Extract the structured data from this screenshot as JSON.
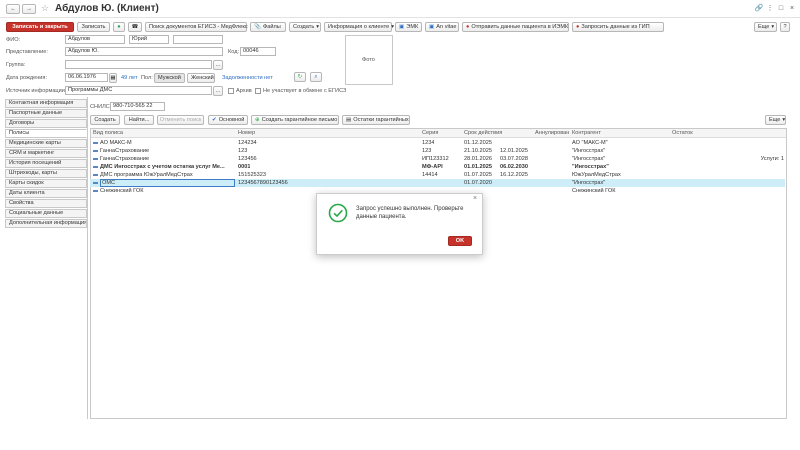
{
  "window": {
    "title": "Абдулов Ю. (Клиент)",
    "controls": [
      "link-icon",
      "more-icon",
      "maximize-icon",
      "close-icon"
    ]
  },
  "toolbar": {
    "save_close": "Записать и закрыть",
    "save": "Записать",
    "search_egisz": "Поиск документов ЕГИСЗ - МедФлекс",
    "files": "Файлы",
    "create": "Создать",
    "client_info": "Информация о клиенте",
    "emk": "ЭМК",
    "anvitae": "An vitae",
    "send_iemk": "Отправить данные пациента в ИЭМК",
    "request_gip": "Запросить данные из ГИП",
    "more": "Еще"
  },
  "form": {
    "fio_label": "ФИО:",
    "last_name": "Абдулов",
    "first_name": "Юрий",
    "middle_name": "",
    "photo_label": "Фото",
    "representation_label": "Представление:",
    "representation": "Абдулов Ю.",
    "code_label": "Код:",
    "code": "00046",
    "group_label": "Группа:",
    "group": "",
    "birthdate_label": "Дата рождения:",
    "birthdate": "06.06.1976",
    "age": "49 лет",
    "sex_label": "Пол:",
    "sex_male": "Мужской",
    "sex_female": "Женский",
    "debt": "Задолженности нет",
    "source_label": "Источник информации:",
    "source": "Программы ДМС",
    "archive_label": "Архив",
    "no_exchange_label": "Не участвует в обмене с ЕГИСЗ"
  },
  "sidebar": {
    "items": [
      {
        "label": "Контактная информация",
        "active": false
      },
      {
        "label": "Паспортные данные",
        "active": false
      },
      {
        "label": "Договоры",
        "active": false
      },
      {
        "label": "Полисы",
        "active": true
      },
      {
        "label": "Медицинские карты",
        "active": false
      },
      {
        "label": "CRM и маркетинг",
        "active": false
      },
      {
        "label": "История посещений",
        "active": false
      },
      {
        "label": "Штрихкоды, карты",
        "active": false
      },
      {
        "label": "Карты скидок",
        "active": false
      },
      {
        "label": "Даты клиента",
        "active": false
      },
      {
        "label": "Свойства",
        "active": false
      },
      {
        "label": "Социальные данные",
        "active": false
      },
      {
        "label": "Дополнительная информация",
        "active": false
      }
    ]
  },
  "policies": {
    "snils_label": "СНИЛС:",
    "snils": "980-710-565 22",
    "btn_create": "Создать",
    "btn_find": "Найти...",
    "btn_cancel_search": "Отменить поиск",
    "btn_main": "Основной",
    "btn_guarantee": "Создать гарантийное письмо",
    "btn_remains": "Остатки гарантийных",
    "btn_more": "Еще",
    "columns": [
      "Вид полиса",
      "Номер",
      "Серия",
      "Срок действия",
      "",
      "Аннулирован",
      "Контрагент",
      "Остаток"
    ],
    "rows": [
      {
        "type": "АО МАКС-М",
        "number": "124234",
        "series": "1234",
        "date_from": "01.12.2025",
        "date_to": "",
        "annulled": "",
        "contractor": "АО \"МАКС-М\"",
        "remainder": "",
        "bold": false,
        "selected": false
      },
      {
        "type": "ГаннаСтрахование",
        "number": "123",
        "series": "123",
        "date_from": "21.10.2025",
        "date_to": "12.01.2025",
        "annulled": "",
        "contractor": "\"Ингосстрах\"",
        "remainder": "",
        "bold": false,
        "selected": false
      },
      {
        "type": "ГаннаСтрахование",
        "number": "123456",
        "series": "ИП123312",
        "date_from": "28.01.2026",
        "date_to": "03.07.2028",
        "annulled": "",
        "contractor": "\"Ингосстрах\"",
        "remainder": "Услуги: 1",
        "bold": false,
        "selected": false
      },
      {
        "type": "ДМС Ингосстрах с учетом остатка услуг Ме...",
        "number": "0001",
        "series": "МФ-API",
        "date_from": "01.01.2025",
        "date_to": "06.02.2030",
        "annulled": "",
        "contractor": "\"Ингосстрах\"",
        "remainder": "",
        "bold": true,
        "selected": false
      },
      {
        "type": "ДМС программа ЮжУралМедСтрах",
        "number": "151525323",
        "series": "14414",
        "date_from": "01.07.2025",
        "date_to": "16.12.2025",
        "annulled": "",
        "contractor": "ЮжУралМедСтрах",
        "remainder": "",
        "bold": false,
        "selected": false
      },
      {
        "type": "ОМС",
        "number": "1234567890123456",
        "series": "",
        "date_from": "01.07.2020",
        "date_to": "",
        "annulled": "",
        "contractor": "\"Ингосстрах\"",
        "remainder": "",
        "bold": false,
        "selected": true
      },
      {
        "type": "Снежинский ГОК",
        "number": "",
        "series": "",
        "date_from": "",
        "date_to": "",
        "annulled": "",
        "contractor": "Снежинский ГОК",
        "remainder": "",
        "bold": false,
        "selected": false
      }
    ]
  },
  "dialog": {
    "message_line1": "Запрос успешно выполнен. Проверьте",
    "message_line2": "данные пациента.",
    "ok": "OK"
  },
  "colors": {
    "primary": "#c7332b",
    "selected_row": "#cdeef8",
    "success": "#2aa84a",
    "link": "#2a6cc4"
  }
}
